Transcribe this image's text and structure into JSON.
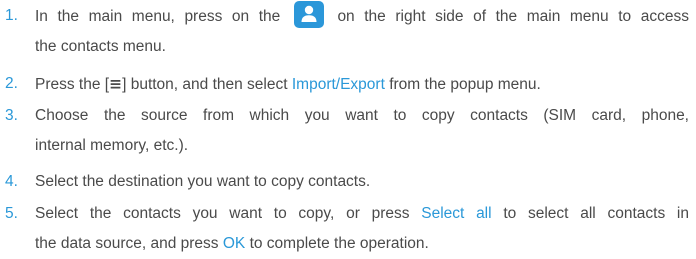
{
  "steps": [
    {
      "num": "1.",
      "before_icon": "In the main menu, press on the",
      "icon": "contacts-icon",
      "after_icon": "on the right side of the main menu to access",
      "line2": "the contacts menu."
    },
    {
      "num": "2.",
      "before_button": "Press the [",
      "button_glyph": "≡",
      "after_button": "] button, and then select",
      "highlight": "Import/Export",
      "after_highlight": "from the popup menu."
    },
    {
      "num": "3.",
      "line1": "Choose the source from which you want to copy contacts (SIM card, phone,",
      "line2": "internal memory, etc.)."
    },
    {
      "num": "4.",
      "line1": "Select the destination you want to copy contacts."
    },
    {
      "num": "5.",
      "before_hl1": "Select the contacts you want to copy, or press",
      "hl1": "Select all",
      "after_hl1": "to select all contacts in",
      "before_hl2": "the data source, and press",
      "hl2": "OK",
      "after_hl2": "to complete the operation."
    }
  ],
  "colors": {
    "accent": "#2a98d8",
    "text": "#4a4a4a",
    "icon_bg": "#2b97d9"
  }
}
